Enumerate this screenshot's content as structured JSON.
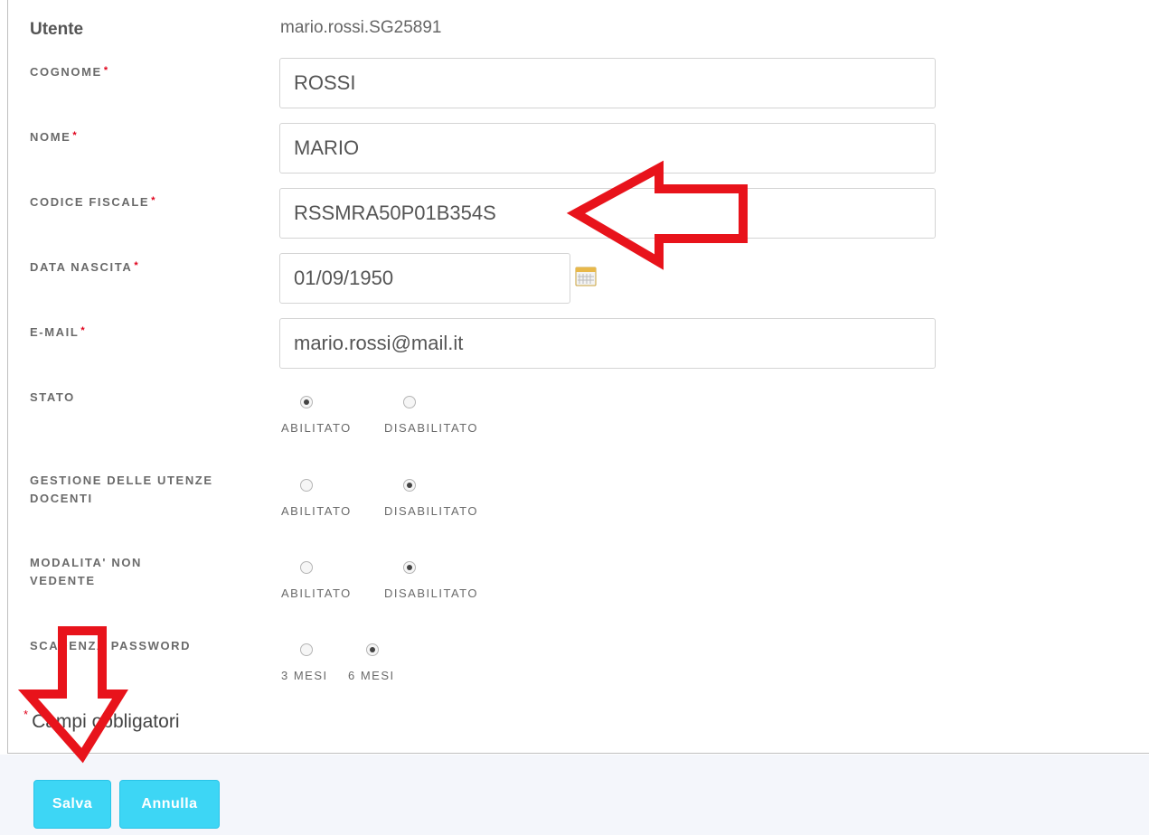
{
  "user": {
    "label": "Utente",
    "value": "mario.rossi.SG25891"
  },
  "fields": {
    "cognome": {
      "label": "COGNOME",
      "value": "ROSSI"
    },
    "nome": {
      "label": "NOME",
      "value": "MARIO"
    },
    "codice_fiscale": {
      "label": "CODICE FISCALE",
      "value": "RSSMRA50P01B354S"
    },
    "data_nascita": {
      "label": "DATA NASCITA",
      "value": "01/09/1950",
      "icon": "calendar-icon"
    },
    "email": {
      "label": "E-MAIL",
      "value": "mario.rossi@mail.it"
    }
  },
  "required_marker": "*",
  "radios": {
    "stato": {
      "label": "STATO",
      "options": [
        "ABILITATO",
        "DISABILITATO"
      ],
      "selected": "ABILITATO"
    },
    "gestione": {
      "label_line1": "GESTIONE DELLE UTENZE",
      "label_line2": "DOCENTI",
      "options": [
        "ABILITATO",
        "DISABILITATO"
      ],
      "selected": "DISABILITATO"
    },
    "non_vedente": {
      "label_line1": "MODALITA' NON",
      "label_line2": "VEDENTE",
      "options": [
        "ABILITATO",
        "DISABILITATO"
      ],
      "selected": "DISABILITATO"
    },
    "scadenza": {
      "label": "SCADENZA PASSWORD",
      "options": [
        "3 MESI",
        "6 MESI"
      ],
      "selected": "6 MESI"
    }
  },
  "required_note": "Campi obbligatori",
  "buttons": {
    "save": "Salva",
    "cancel": "Annulla"
  },
  "colors": {
    "accent": "#3dd6f5",
    "required": "#e0001a",
    "annotation": "#e8131b"
  },
  "annotations": [
    "arrow-left-icon",
    "arrow-down-icon"
  ]
}
